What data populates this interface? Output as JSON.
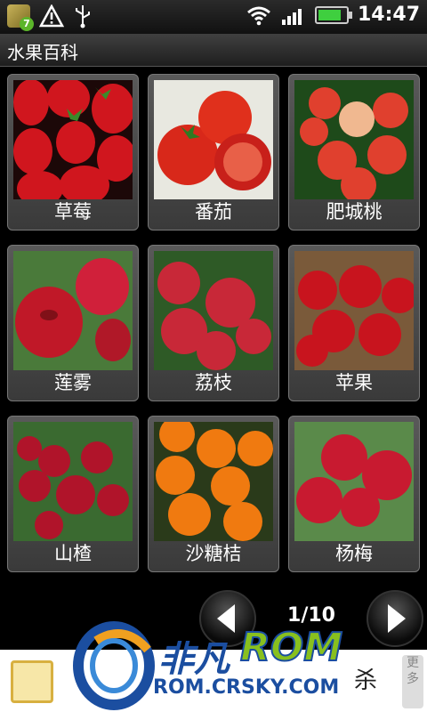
{
  "status": {
    "time": "14:47",
    "notification_count": "7",
    "battery_level": 0.85
  },
  "app": {
    "title": "水果百科"
  },
  "fruits": [
    {
      "label": "草莓",
      "icon": "strawberry-icon",
      "color": "#c8141c"
    },
    {
      "label": "番茄",
      "icon": "tomato-icon",
      "color": "#d8281a"
    },
    {
      "label": "肥城桃",
      "icon": "peach-icon",
      "color": "#d8402a"
    },
    {
      "label": "莲雾",
      "icon": "wax-apple-icon",
      "color": "#c01828"
    },
    {
      "label": "荔枝",
      "icon": "lychee-icon",
      "color": "#c82838"
    },
    {
      "label": "苹果",
      "icon": "apple-icon",
      "color": "#b81420"
    },
    {
      "label": "山楂",
      "icon": "hawthorn-icon",
      "color": "#b0142a"
    },
    {
      "label": "沙糖桔",
      "icon": "tangerine-icon",
      "color": "#f07a10"
    },
    {
      "label": "杨梅",
      "icon": "bayberry-icon",
      "color": "#c81a30"
    }
  ],
  "pager": {
    "text": "1/10"
  },
  "ad": {
    "char": "杀",
    "side_text": "更多"
  },
  "watermark": {
    "brand_cn": "非凡",
    "brand_rom": "ROM",
    "url": "ROM.CRSKY.COM"
  }
}
